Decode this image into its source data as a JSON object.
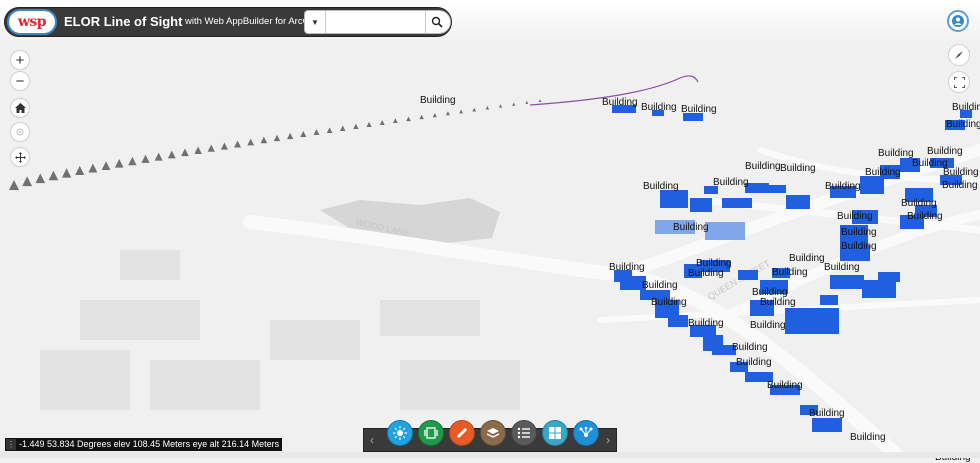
{
  "header": {
    "logo_text": "wsp",
    "title": "ELOR Line of Sight",
    "subtitle": "with Web AppBuilder for ArcGIS"
  },
  "search": {
    "placeholder": "",
    "value": ""
  },
  "map": {
    "building_label": "Building",
    "road_label_1": "WOOD LANE",
    "road_label_2": "QUEEN STREET",
    "coordinates": "-1.449 53.834 Degrees  elev 108.45 Meters  eye alt 216.14 Meters"
  },
  "icons": {
    "zoom_in": "plus-icon",
    "zoom_out": "minus-icon",
    "home": "home-icon",
    "locate": "locate-icon",
    "navigate": "pan-icon",
    "compass": "compass-icon",
    "fullscreen": "fullscreen-icon",
    "user": "user-icon",
    "search": "search-icon"
  },
  "toolbar": {
    "prev": "‹",
    "next": "›",
    "buttons": [
      {
        "name": "daylight-icon",
        "color": "#1ea2e0"
      },
      {
        "name": "slides-icon",
        "color": "#1f9a4b"
      },
      {
        "name": "measure-icon",
        "color": "#e75c26"
      },
      {
        "name": "layers-icon",
        "color": "#8a6a4a"
      },
      {
        "name": "layer-list-icon",
        "color": "#5a5a5a"
      },
      {
        "name": "basemap-gallery-icon",
        "color": "#3aa6c8"
      },
      {
        "name": "share-icon",
        "color": "#1e90d8"
      }
    ]
  },
  "colors": {
    "header_bg": "#3a3a3a",
    "building": "#1f5fe0",
    "accent": "#3b86c9"
  }
}
